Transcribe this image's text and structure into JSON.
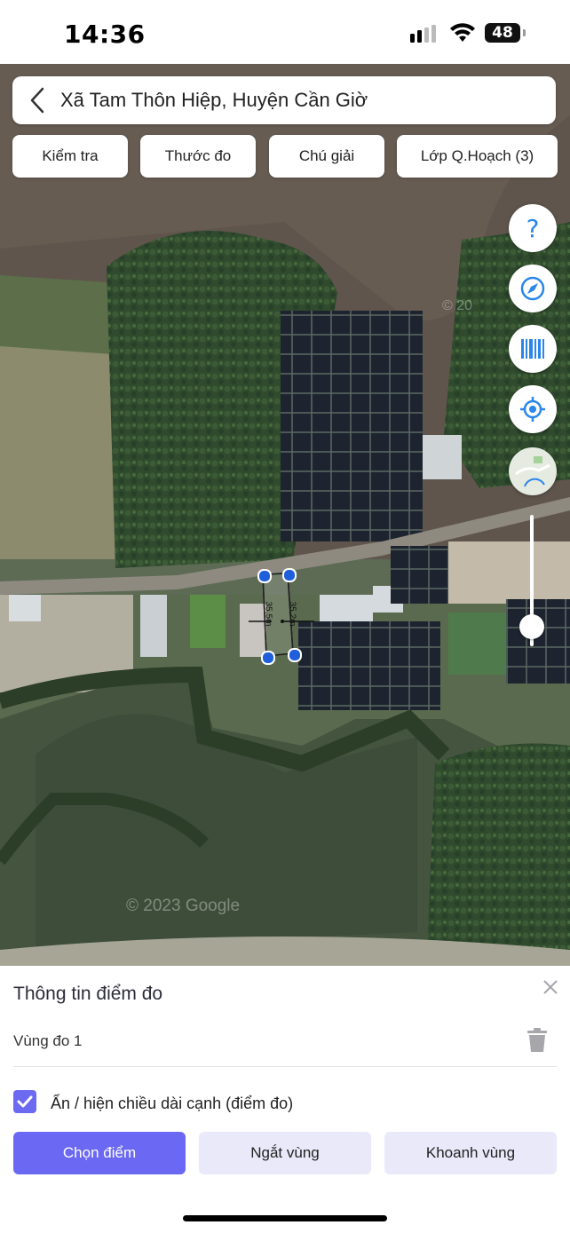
{
  "status_bar": {
    "time": "14:36",
    "battery": "48"
  },
  "header": {
    "title": "Xã Tam Thôn Hiệp, Huyện Cần Giờ"
  },
  "tabs": [
    {
      "label": "Kiểm tra"
    },
    {
      "label": "Thước đo"
    },
    {
      "label": "Chú giải"
    },
    {
      "label": "Lớp Q.Hoạch (3)"
    }
  ],
  "map": {
    "attribution_partial": "© 20",
    "attribution": "© 2023 Google",
    "measure_labels": [
      "35,5m",
      "35,2m"
    ],
    "zoom_level": 0.15,
    "buttons": [
      "help-icon",
      "compass-icon",
      "barcode-icon",
      "locate-icon",
      "map-layer-icon"
    ]
  },
  "sheet": {
    "title": "Thông tin điểm đo",
    "zone": "Vùng đo 1",
    "toggle_label": "Ẩn / hiện chiều dài cạnh (điểm đo)",
    "toggle_checked": true,
    "buttons": {
      "select": "Chọn điểm",
      "break": "Ngắt vùng",
      "area": "Khoanh vùng"
    }
  },
  "colors": {
    "accent": "#6b68f3",
    "secondary": "#e9e9f9",
    "map_marker": "#1f5fdc"
  }
}
